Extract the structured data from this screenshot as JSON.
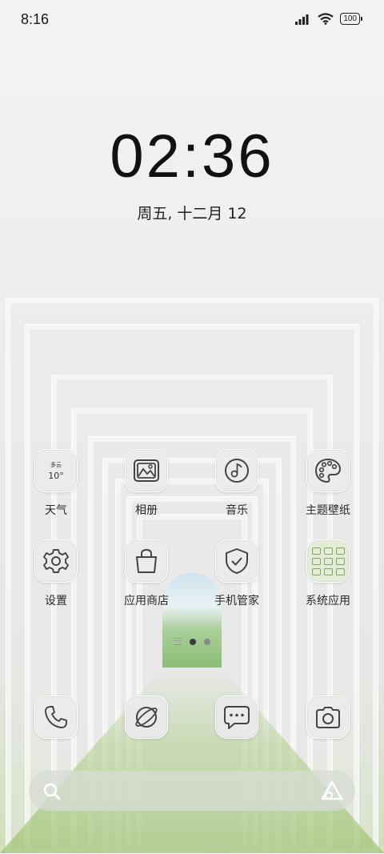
{
  "status_bar": {
    "time": "8:16",
    "battery": "100",
    "icons": [
      "signal-icon",
      "wifi-icon",
      "battery-icon"
    ]
  },
  "lock_clock": {
    "time": "02:36",
    "date": "周五, 十二月 12"
  },
  "apps_row1": [
    {
      "label": "天气",
      "icon": "weather-icon",
      "weather_desc": "多云",
      "temp": "10°"
    },
    {
      "label": "相册",
      "icon": "gallery-icon"
    },
    {
      "label": "音乐",
      "icon": "music-icon"
    },
    {
      "label": "主题壁纸",
      "icon": "palette-icon"
    }
  ],
  "apps_row2": [
    {
      "label": "设置",
      "icon": "gear-icon"
    },
    {
      "label": "应用商店",
      "icon": "shopping-bag-icon"
    },
    {
      "label": "手机管家",
      "icon": "shield-check-icon"
    },
    {
      "label": "系统应用",
      "icon": "folder-icon"
    }
  ],
  "dock": [
    {
      "icon": "phone-icon"
    },
    {
      "icon": "browser-icon"
    },
    {
      "icon": "message-icon"
    },
    {
      "icon": "camera-icon"
    }
  ],
  "pager": {
    "pages": 2,
    "current": 1
  },
  "search_bar": {
    "left_icon": "search-icon",
    "right_icon": "assistant-icon"
  }
}
